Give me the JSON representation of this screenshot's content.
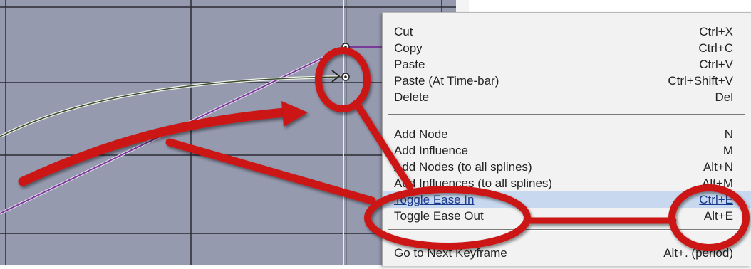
{
  "context_menu": {
    "items": [
      {
        "label": "Cut",
        "shortcut": "Ctrl+X"
      },
      {
        "label": "Copy",
        "shortcut": "Ctrl+C"
      },
      {
        "label": "Paste",
        "shortcut": "Ctrl+V"
      },
      {
        "label": "Paste (At Time-bar)",
        "shortcut": "Ctrl+Shift+V"
      },
      {
        "label": "Delete",
        "shortcut": "Del"
      },
      {
        "label": "Add Node",
        "shortcut": "N"
      },
      {
        "label": "Add Influence",
        "shortcut": "M"
      },
      {
        "label": "Add Nodes (to all splines)",
        "shortcut": "Alt+N"
      },
      {
        "label": "Add Influences (to all splines)",
        "shortcut": "Alt+M"
      },
      {
        "label": "Toggle Ease In",
        "shortcut": "Ctrl+E",
        "highlighted": true
      },
      {
        "label": "Toggle Ease Out",
        "shortcut": "Alt+E"
      },
      {
        "label": "Go to Next Keyframe",
        "shortcut": "Alt+. (period)"
      }
    ]
  },
  "colors": {
    "graph_background": "#969aaf",
    "grid_line": "#2b2b35",
    "curve_purple": "#7a3a9a",
    "curve_green": "#3c4a30",
    "annotation_red": "#cc1414",
    "highlight": "#c8d8ee"
  },
  "icons": [
    "keyframe-node-icon",
    "ease-arrow-icon"
  ]
}
